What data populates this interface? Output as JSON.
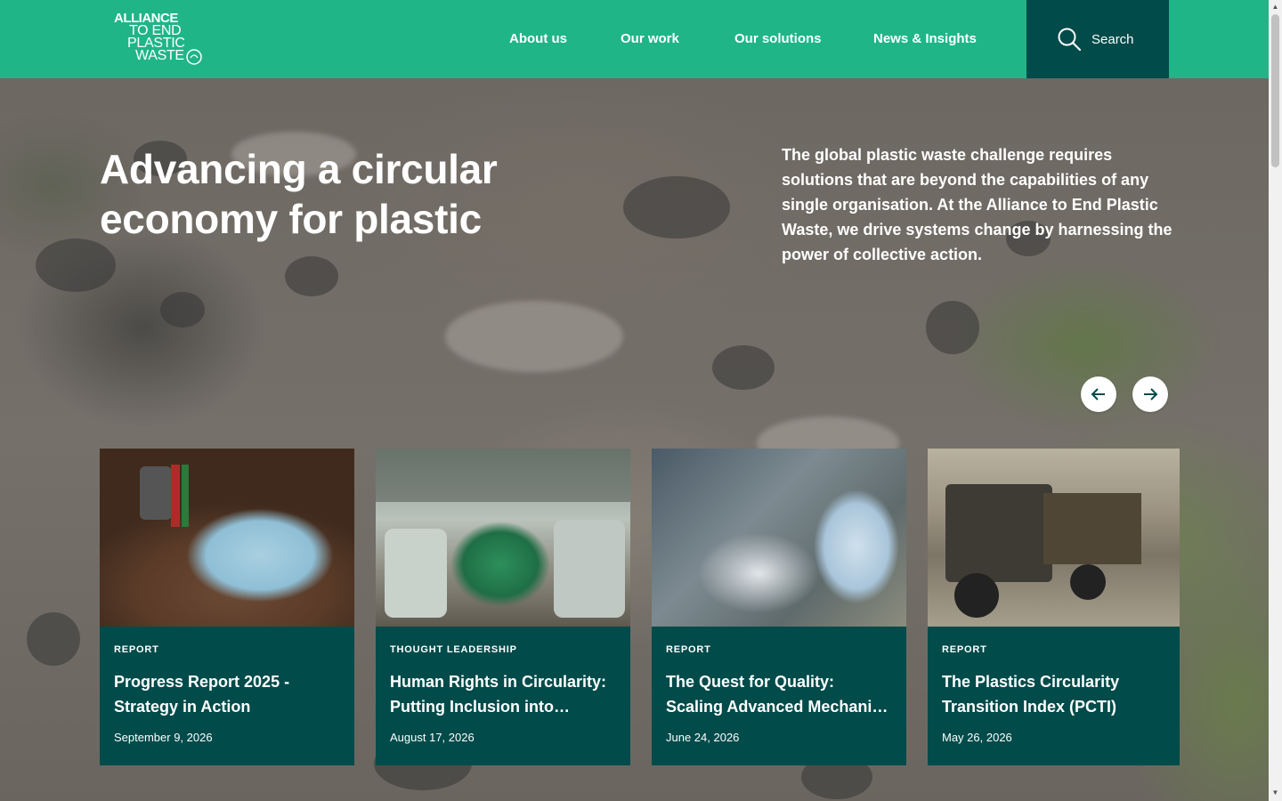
{
  "header": {
    "logo_lines": [
      "ALLIANCE",
      "TO END",
      "PLASTIC",
      "WASTE"
    ],
    "nav": [
      "About us",
      "Our work",
      "Our solutions",
      "News & Insights"
    ],
    "search_label": "Search"
  },
  "hero": {
    "title": "Advancing a circular economy for plastic",
    "text": "The global plastic waste challenge requires solutions that are beyond the capabilities of any single organisation. At the Alliance to End Plastic Waste, we drive systems change by harnessing the power of collective action."
  },
  "cards": [
    {
      "tag": "REPORT",
      "title": "Progress Report 2025 - Strategy in Action",
      "date": "September 9, 2026"
    },
    {
      "tag": "THOUGHT LEADERSHIP",
      "title": "Human Rights in Circularity: Putting Inclusion into…",
      "date": "August 17, 2026"
    },
    {
      "tag": "REPORT",
      "title": "The Quest for Quality: Scaling Advanced Mechani…",
      "date": "June 24, 2026"
    },
    {
      "tag": "REPORT",
      "title": "The Plastics Circularity Transition Index (PCTI)",
      "date": "May 26, 2026"
    }
  ],
  "colors": {
    "header_bg": "#1fb587",
    "search_bg": "#014b4a",
    "card_bg": "#014b4a"
  },
  "icons": [
    "search-icon",
    "arrow-left-icon",
    "arrow-right-icon"
  ]
}
